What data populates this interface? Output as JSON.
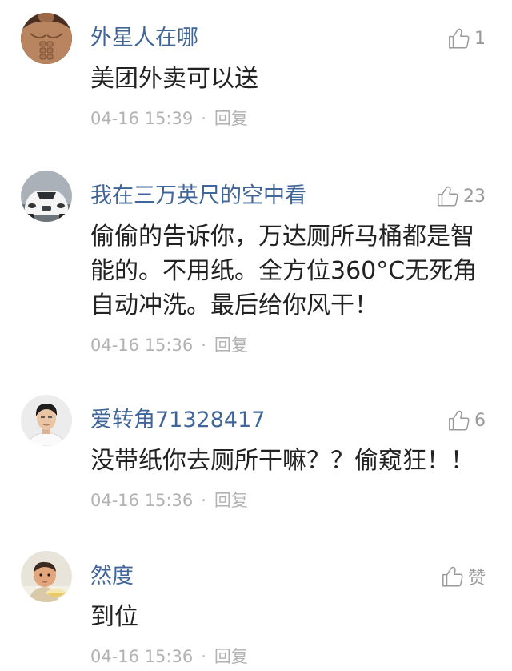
{
  "comments": [
    {
      "username": "外星人在哪",
      "likes": "1",
      "text": "美团外卖可以送",
      "time": "04-16 15:39",
      "separator": "·",
      "reply": "回复"
    },
    {
      "username": "我在三万英尺的空中看",
      "likes": "23",
      "text": "偷偷的告诉你，万达厕所马桶都是智能的。不用纸。全方位360°C无死角自动冲洗。最后给你风干！",
      "time": "04-16 15:36",
      "separator": "·",
      "reply": "回复"
    },
    {
      "username": "爱转角71328417",
      "likes": "6",
      "text": "没带纸你去厕所干嘛？？偷窥狂！！",
      "time": "04-16 15:36",
      "separator": "·",
      "reply": "回复"
    },
    {
      "username": "然度",
      "likes": "赞",
      "text": "到位",
      "time": "04-16 15:36",
      "separator": "·",
      "reply": "回复"
    }
  ],
  "icons": {
    "like": "thumbs-up-icon"
  },
  "colors": {
    "background": "#ffffff",
    "username": "#406599",
    "comment_text": "#222222",
    "meta_text": "#b2b2b2",
    "like_icon": "#9a9a9a"
  }
}
